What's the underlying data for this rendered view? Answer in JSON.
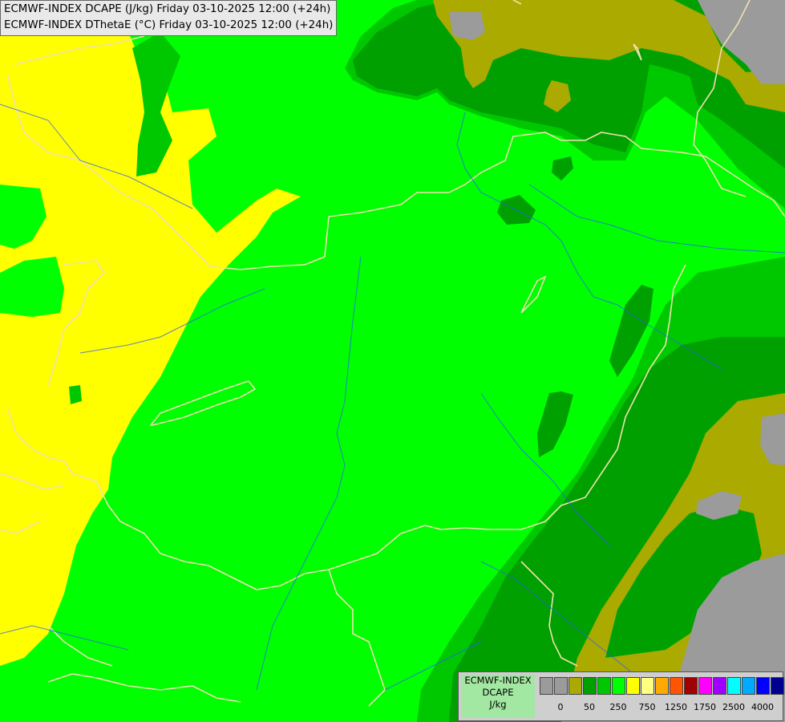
{
  "titles": {
    "line1": "ECMWF-INDEX DCAPE (J/kg) Friday 03-10-2025 12:00 (+24h)",
    "line2": "ECMWF-INDEX DThetaE (°C) Friday 03-10-2025 12:00 (+24h)"
  },
  "legend": {
    "label_line1": "ECMWF-INDEX",
    "label_line2": "DCAPE",
    "label_line3": "J/kg",
    "colors": [
      "#9b9b9b",
      "#9b9b9b",
      "#aaaa00",
      "#00a000",
      "#00c800",
      "#00ff00",
      "#ffff00",
      "#ffff80",
      "#ffaa00",
      "#ff5500",
      "#a00000",
      "#ff00ff",
      "#a000ff",
      "#00ffff",
      "#00aaff",
      "#0000ff",
      "#000090"
    ],
    "ticks": [
      "0",
      "50",
      "250",
      "750",
      "1250",
      "1750",
      "2500",
      "4000"
    ]
  },
  "map_colors": {
    "gray": "#9b9b9b",
    "olive": "#aaaa00",
    "dark_green": "#00a000",
    "green": "#00c800",
    "bright_green": "#00ff00",
    "yellow": "#ffff00",
    "border": "#f0e0b0",
    "river": "#2060ff"
  }
}
